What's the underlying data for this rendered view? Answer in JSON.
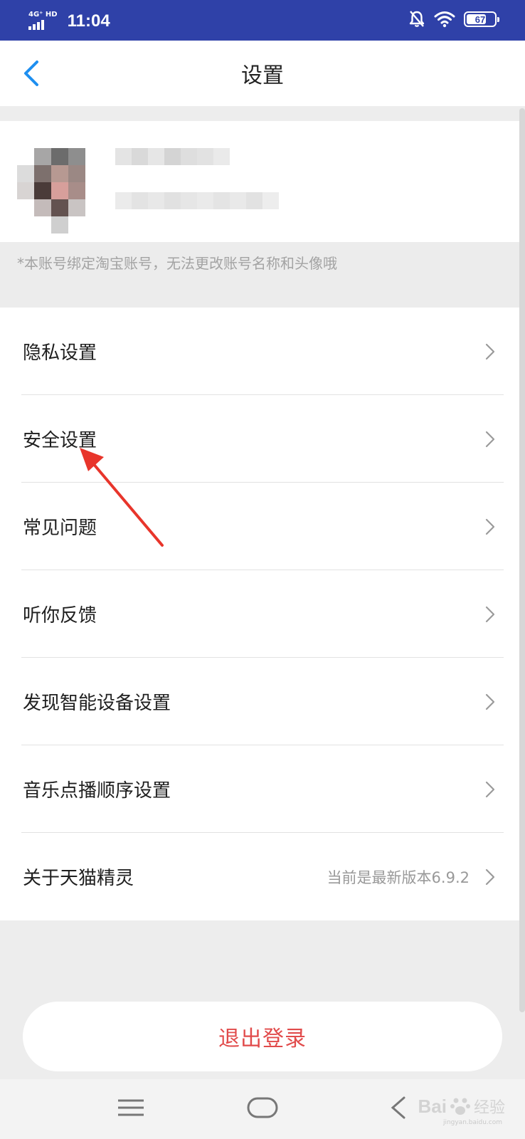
{
  "status_bar": {
    "network": "4G⁺ HD",
    "time": "11:04",
    "battery": "67"
  },
  "header": {
    "title": "设置"
  },
  "profile": {
    "notice": "*本账号绑定淘宝账号，无法更改账号名称和头像哦"
  },
  "settings": {
    "items": [
      {
        "label": "隐私设置",
        "value": ""
      },
      {
        "label": "安全设置",
        "value": ""
      },
      {
        "label": "常见问题",
        "value": ""
      },
      {
        "label": "听你反馈",
        "value": ""
      },
      {
        "label": "发现智能设备设置",
        "value": ""
      },
      {
        "label": "音乐点播顺序设置",
        "value": ""
      },
      {
        "label": "关于天猫精灵",
        "value": "当前是最新版本6.9.2"
      }
    ]
  },
  "logout": {
    "label": "退出登录"
  },
  "watermark": {
    "brand": "Bai",
    "brand_suffix": "经验",
    "url": "jingyan.baidu.com"
  },
  "colors": {
    "status_bar": "#2f41a8",
    "accent_back": "#1e8ff0",
    "logout_text": "#e14b4b",
    "annotation_arrow": "#e8352b"
  }
}
